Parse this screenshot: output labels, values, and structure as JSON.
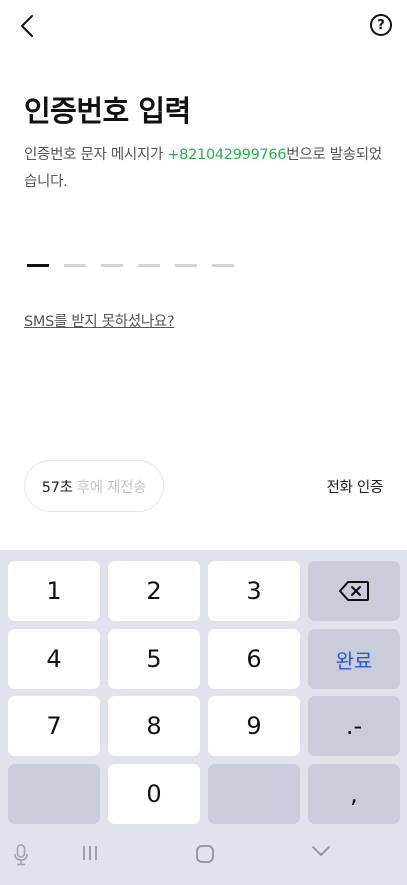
{
  "header": {
    "back_icon": "back-arrow-icon",
    "help_icon": "question-mark-icon",
    "help_glyph": "?"
  },
  "title": "인증번호 입력",
  "description": {
    "prefix": "인증번호 문자 메시지가 ",
    "phone": "+821042999766",
    "suffix": "번으로 발송되었습니다."
  },
  "code_input": {
    "length": 6,
    "filled": 0
  },
  "sms_help_link": "SMS를 받지 못하셨나요?",
  "resend": {
    "countdown": "57초",
    "label": "후에 재전송"
  },
  "phone_auth_label": "전화 인증",
  "keyboard": {
    "keys": [
      {
        "label": "1"
      },
      {
        "label": "2"
      },
      {
        "label": "3"
      },
      {
        "label": "",
        "icon": "backspace-icon"
      },
      {
        "label": "4"
      },
      {
        "label": "5"
      },
      {
        "label": "6"
      },
      {
        "label": "완료"
      },
      {
        "label": "7"
      },
      {
        "label": "8"
      },
      {
        "label": "9"
      },
      {
        "label": ".-"
      },
      {
        "label": ""
      },
      {
        "label": "0"
      },
      {
        "label": ""
      },
      {
        "label": ","
      }
    ]
  },
  "navbar": {
    "icons": [
      "microphone-icon",
      "recent-apps-icon",
      "home-icon",
      "hide-keyboard-icon"
    ]
  },
  "colors": {
    "accent_green": "#23b54d",
    "done_blue": "#2b57d8",
    "keyboard_bg": "#e0e3ec"
  }
}
